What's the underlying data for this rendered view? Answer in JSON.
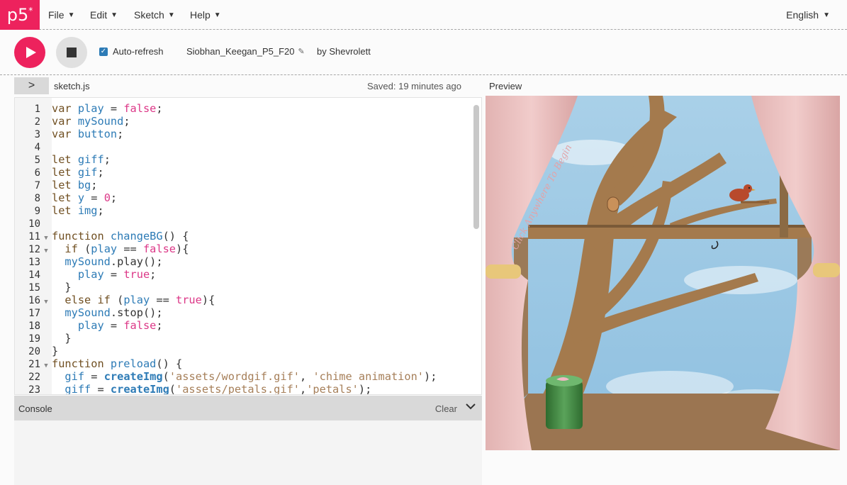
{
  "nav": {
    "logo": "p5",
    "logo_sup": "*",
    "menus": [
      "File",
      "Edit",
      "Sketch",
      "Help"
    ],
    "language": "English"
  },
  "toolbar": {
    "auto_refresh_label": "Auto-refresh",
    "auto_refresh_checked": true,
    "sketch_name": "Siobhan_Keegan_P5_F20",
    "byline": "by Shevrolett"
  },
  "editor": {
    "filename": "sketch.js",
    "saved_status": "Saved: 19 minutes ago",
    "lines": [
      {
        "n": "1",
        "fold": false,
        "tokens": [
          [
            "kw2",
            "var "
          ],
          [
            "def",
            "play"
          ],
          [
            "code",
            " = "
          ],
          [
            "atom",
            "false"
          ],
          [
            "code",
            ";"
          ]
        ]
      },
      {
        "n": "2",
        "fold": false,
        "tokens": [
          [
            "kw2",
            "var "
          ],
          [
            "def",
            "mySound"
          ],
          [
            "code",
            ";"
          ]
        ]
      },
      {
        "n": "3",
        "fold": false,
        "tokens": [
          [
            "kw2",
            "var "
          ],
          [
            "def",
            "button"
          ],
          [
            "code",
            ";"
          ]
        ]
      },
      {
        "n": "4",
        "fold": false,
        "tokens": []
      },
      {
        "n": "5",
        "fold": false,
        "tokens": [
          [
            "kw2",
            "let "
          ],
          [
            "def",
            "giff"
          ],
          [
            "code",
            ";"
          ]
        ]
      },
      {
        "n": "6",
        "fold": false,
        "tokens": [
          [
            "kw2",
            "let "
          ],
          [
            "def",
            "gif"
          ],
          [
            "code",
            ";"
          ]
        ]
      },
      {
        "n": "7",
        "fold": false,
        "tokens": [
          [
            "kw2",
            "let "
          ],
          [
            "def",
            "bg"
          ],
          [
            "code",
            ";"
          ]
        ]
      },
      {
        "n": "8",
        "fold": false,
        "tokens": [
          [
            "kw2",
            "let "
          ],
          [
            "def",
            "y"
          ],
          [
            "code",
            " = "
          ],
          [
            "atom",
            "0"
          ],
          [
            "code",
            ";"
          ]
        ]
      },
      {
        "n": "9",
        "fold": false,
        "tokens": [
          [
            "kw2",
            "let "
          ],
          [
            "def",
            "img"
          ],
          [
            "code",
            ";"
          ]
        ]
      },
      {
        "n": "10",
        "fold": false,
        "tokens": []
      },
      {
        "n": "11",
        "fold": true,
        "tokens": [
          [
            "kw2",
            "function "
          ],
          [
            "def",
            "changeBG"
          ],
          [
            "code",
            "() {"
          ]
        ]
      },
      {
        "n": "12",
        "fold": true,
        "tokens": [
          [
            "code",
            "  "
          ],
          [
            "kw2",
            "if "
          ],
          [
            "code",
            "("
          ],
          [
            "def",
            "play"
          ],
          [
            "code",
            " == "
          ],
          [
            "atom",
            "false"
          ],
          [
            "code",
            "){"
          ]
        ]
      },
      {
        "n": "13",
        "fold": false,
        "tokens": [
          [
            "code",
            "  "
          ],
          [
            "def",
            "mySound"
          ],
          [
            "code",
            ".play();"
          ]
        ]
      },
      {
        "n": "14",
        "fold": false,
        "tokens": [
          [
            "code",
            "    "
          ],
          [
            "def",
            "play"
          ],
          [
            "code",
            " = "
          ],
          [
            "atom",
            "true"
          ],
          [
            "code",
            ";"
          ]
        ]
      },
      {
        "n": "15",
        "fold": false,
        "tokens": [
          [
            "code",
            "  }"
          ]
        ]
      },
      {
        "n": "16",
        "fold": true,
        "tokens": [
          [
            "code",
            "  "
          ],
          [
            "kw2",
            "else if "
          ],
          [
            "code",
            "("
          ],
          [
            "def",
            "play"
          ],
          [
            "code",
            " == "
          ],
          [
            "atom",
            "true"
          ],
          [
            "code",
            "){"
          ]
        ]
      },
      {
        "n": "17",
        "fold": false,
        "tokens": [
          [
            "code",
            "  "
          ],
          [
            "def",
            "mySound"
          ],
          [
            "code",
            ".stop();"
          ]
        ]
      },
      {
        "n": "18",
        "fold": false,
        "tokens": [
          [
            "code",
            "    "
          ],
          [
            "def",
            "play"
          ],
          [
            "code",
            " = "
          ],
          [
            "atom",
            "false"
          ],
          [
            "code",
            ";"
          ]
        ]
      },
      {
        "n": "19",
        "fold": false,
        "tokens": [
          [
            "code",
            "  }"
          ]
        ]
      },
      {
        "n": "20",
        "fold": false,
        "tokens": [
          [
            "code",
            "}"
          ]
        ]
      },
      {
        "n": "21",
        "fold": true,
        "tokens": [
          [
            "kw2",
            "function "
          ],
          [
            "def",
            "preload"
          ],
          [
            "code",
            "() {"
          ]
        ]
      },
      {
        "n": "22",
        "fold": false,
        "tokens": [
          [
            "code",
            "  "
          ],
          [
            "def",
            "gif"
          ],
          [
            "code",
            " = "
          ],
          [
            "fnb",
            "createImg"
          ],
          [
            "code",
            "("
          ],
          [
            "str",
            "'assets/wordgif.gif'"
          ],
          [
            "code",
            ", "
          ],
          [
            "str",
            "'chime animation'"
          ],
          [
            "code",
            ");"
          ]
        ]
      },
      {
        "n": "23",
        "fold": false,
        "tokens": [
          [
            "code",
            "  "
          ],
          [
            "def",
            "giff"
          ],
          [
            "code",
            " = "
          ],
          [
            "fnb",
            "createImg"
          ],
          [
            "code",
            "("
          ],
          [
            "str",
            "'assets/petals.gif'"
          ],
          [
            "code",
            ","
          ],
          [
            "str",
            "'petals'"
          ],
          [
            "code",
            ");"
          ]
        ]
      }
    ]
  },
  "console": {
    "title": "Console",
    "clear_label": "Clear"
  },
  "preview": {
    "label": "Preview",
    "canvas_text": "Click Anywhere To Begin"
  },
  "colors": {
    "accent": "#ed225d",
    "checkbox": "#2d7bb6"
  }
}
